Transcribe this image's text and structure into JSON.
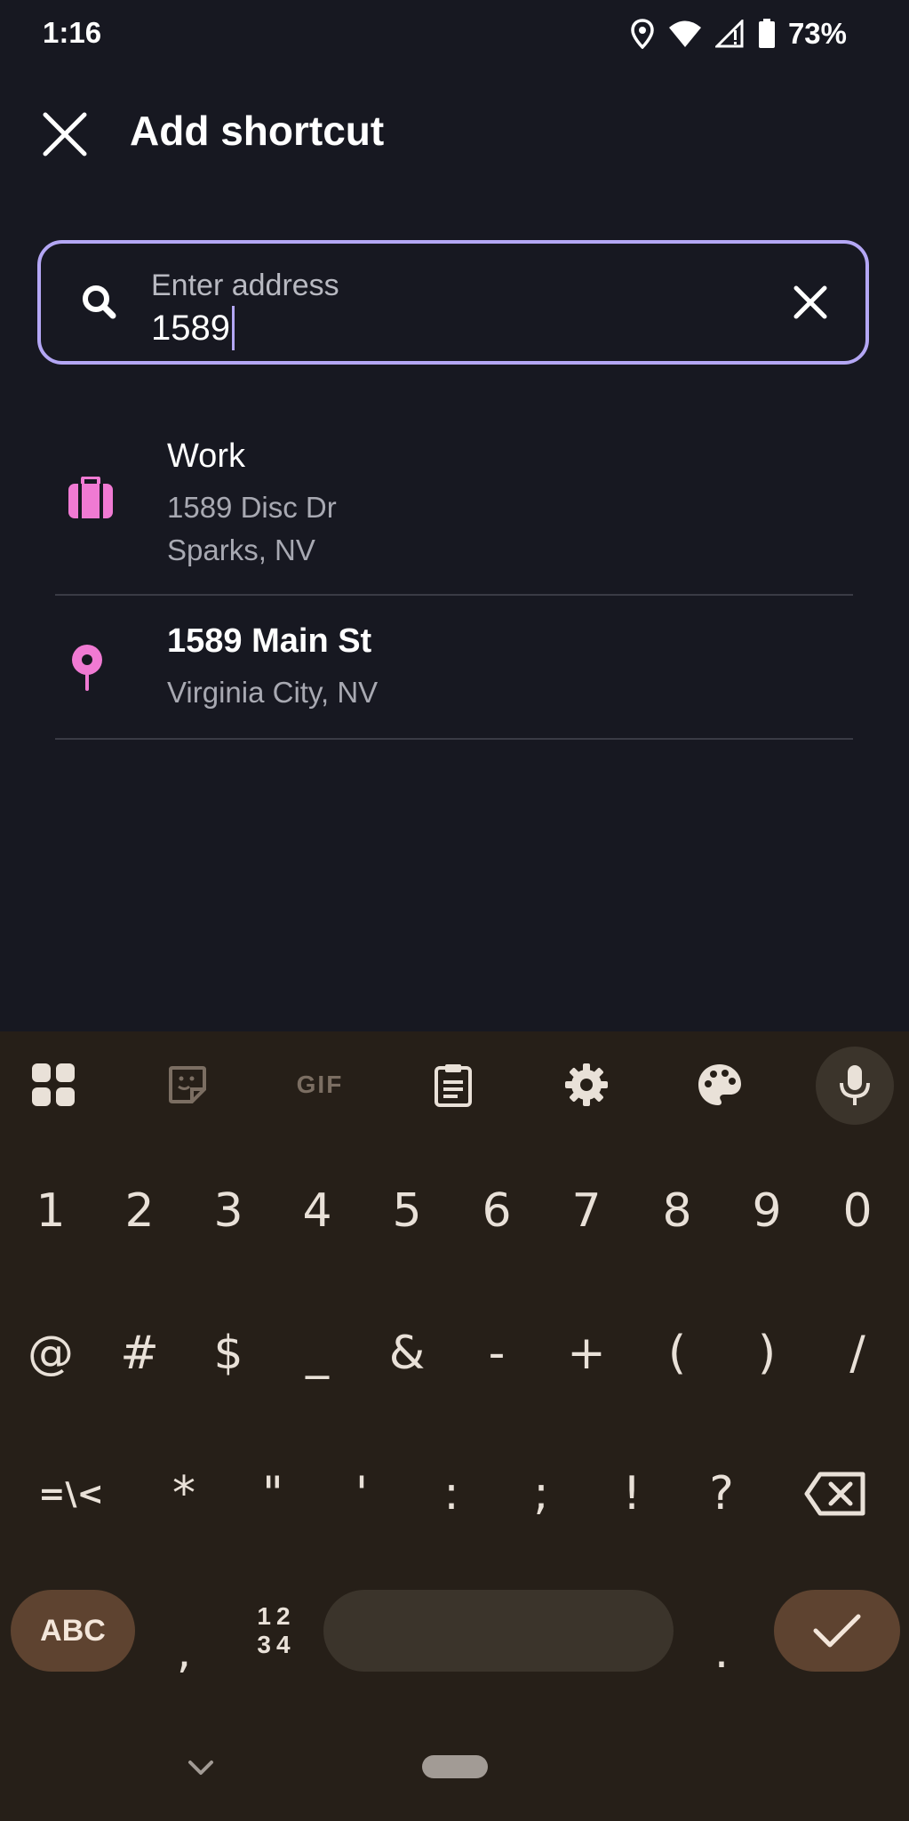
{
  "status_bar": {
    "time": "1:16",
    "battery": "73%"
  },
  "header": {
    "title": "Add shortcut",
    "close_icon": "close-icon"
  },
  "search": {
    "label": "Enter address",
    "value": "1589"
  },
  "results": [
    {
      "title": "Work",
      "line1": "1589 Disc Dr",
      "line2": "Sparks, NV",
      "icon": "briefcase-icon"
    },
    {
      "title": "1589 Main St",
      "line1": "Virginia City, NV",
      "icon": "map-pin-icon"
    }
  ],
  "colors": {
    "accent": "#b4a7f5",
    "icon_pink": "#f07ad3",
    "background": "#171821",
    "keyboard_bg": "#261f18",
    "key_accent": "#5e4330"
  },
  "keyboard": {
    "toolbar": [
      "apps-grid-icon",
      "sticker-icon",
      "GIF",
      "clipboard-icon",
      "settings-icon",
      "palette-icon",
      "microphone-icon"
    ],
    "row1": [
      "1",
      "2",
      "3",
      "4",
      "5",
      "6",
      "7",
      "8",
      "9",
      "0"
    ],
    "row2": [
      "@",
      "#",
      "$",
      "_",
      "&",
      "-",
      "+",
      "(",
      ")",
      "/"
    ],
    "row3": [
      "=\\<",
      "*",
      "\"",
      "'",
      ":",
      ";",
      "!",
      "?"
    ],
    "abc": "ABC",
    "comma": ",",
    "num_top": "12",
    "num_bottom": "34",
    "period": "."
  }
}
